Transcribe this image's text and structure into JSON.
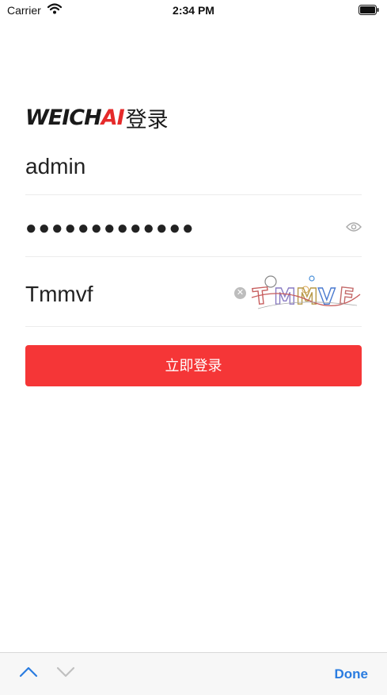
{
  "status_bar": {
    "carrier": "Carrier",
    "time": "2:34 PM",
    "wifi_icon": "wifi-icon",
    "battery_icon": "battery-icon"
  },
  "logo": {
    "brand_main": "WEICH",
    "brand_accent": "AI",
    "title_cn": "登录",
    "accent_color": "#e52a2a"
  },
  "form": {
    "username": {
      "value": "admin"
    },
    "password": {
      "masked_value": "●●●●●●●●●●●●●",
      "toggle_icon": "eye-icon"
    },
    "captcha": {
      "value": "Tmmvf",
      "image_text": "TMMVF",
      "clear_icon": "clear-icon"
    }
  },
  "login_button": {
    "label": "立即登录",
    "color": "#f53637"
  },
  "keyboard_toolbar": {
    "prev_icon": "chevron-up-icon",
    "next_icon": "chevron-down-icon",
    "done_label": "Done",
    "done_color": "#2a7ce0"
  }
}
